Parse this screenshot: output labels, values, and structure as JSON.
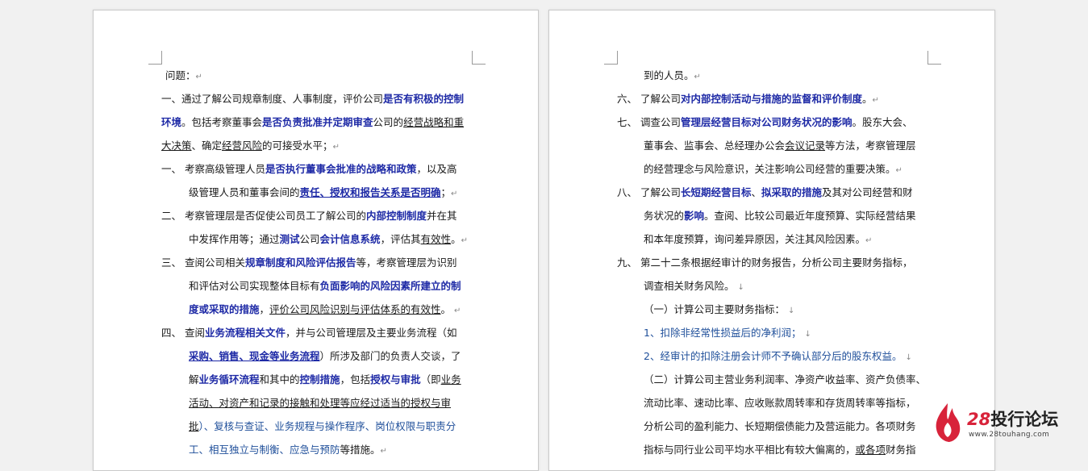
{
  "left_page": {
    "lines": [
      [
        {
          "t": "问题：",
          "s": ""
        },
        {
          "t": "↵",
          "s": "mark"
        }
      ],
      [
        {
          "t": "一、通过了解公司规章制度、人事制度，评价公司",
          "s": ""
        },
        {
          "t": "是否有积极的控制",
          "s": "b"
        }
      ],
      [
        {
          "t": "环境",
          "s": "b"
        },
        {
          "t": "。包括考察董事会",
          "s": ""
        },
        {
          "t": "是否负责批准并定期审查",
          "s": "b"
        },
        {
          "t": "公司的",
          "s": ""
        },
        {
          "t": "经营战略和重",
          "s": "u"
        }
      ],
      [
        {
          "t": "大决策",
          "s": "u"
        },
        {
          "t": "、确定",
          "s": ""
        },
        {
          "t": "经营风险",
          "s": "u"
        },
        {
          "t": "的可接受水平；",
          "s": ""
        },
        {
          "t": "↵",
          "s": "mark"
        }
      ],
      [
        {
          "t": "一、    考察高级管理人员",
          "s": ""
        },
        {
          "t": "是否执行董事会批准的战略和政策",
          "s": "b"
        },
        {
          "t": "，以及高",
          "s": ""
        }
      ],
      [
        {
          "t": "级管理人员和董事会间的",
          "s": ""
        },
        {
          "t": "责任、授权和报告关系是否明确",
          "s": "b u"
        },
        {
          "t": "；",
          "s": ""
        },
        {
          "t": "↵",
          "s": "mark"
        }
      ],
      [
        {
          "t": "二、    考察管理层是否促使公司员工了解公司的",
          "s": ""
        },
        {
          "t": "内部控制制度",
          "s": "b"
        },
        {
          "t": "并在其",
          "s": ""
        }
      ],
      [
        {
          "t": "中发挥作用等；通过",
          "s": ""
        },
        {
          "t": "测试",
          "s": "b"
        },
        {
          "t": "公司",
          "s": ""
        },
        {
          "t": "会计信息系统",
          "s": "b"
        },
        {
          "t": "，评估其",
          "s": ""
        },
        {
          "t": "有效性",
          "s": "u"
        },
        {
          "t": "。",
          "s": ""
        },
        {
          "t": "↵",
          "s": "mark"
        }
      ],
      [
        {
          "t": "三、    查阅公司相关",
          "s": ""
        },
        {
          "t": "规章制度和风险评估报告",
          "s": "b"
        },
        {
          "t": "等，考察管理层为识别",
          "s": ""
        }
      ],
      [
        {
          "t": "和评估对公司实现整体目标有",
          "s": ""
        },
        {
          "t": "负面影响的风险因素所建立的制",
          "s": "b"
        }
      ],
      [
        {
          "t": "度或采取的措施",
          "s": "b"
        },
        {
          "t": "，",
          "s": ""
        },
        {
          "t": "评价公司风险识别与评估体系的有效性",
          "s": "u"
        },
        {
          "t": "。 ",
          "s": ""
        },
        {
          "t": "↵",
          "s": "mark"
        }
      ],
      [
        {
          "t": "四、    查阅",
          "s": ""
        },
        {
          "t": "业务流程相关文件",
          "s": "b"
        },
        {
          "t": "，并与公司管理层及主要业务流程（如",
          "s": ""
        }
      ],
      [
        {
          "t": "采购、销售、现金等业务流程",
          "s": "b u"
        },
        {
          "t": "）所涉及部门的负责人交谈，了",
          "s": ""
        }
      ],
      [
        {
          "t": "解",
          "s": ""
        },
        {
          "t": "业务循环流程",
          "s": "b"
        },
        {
          "t": "和其中的",
          "s": ""
        },
        {
          "t": "控制措施",
          "s": "b"
        },
        {
          "t": "，包括",
          "s": ""
        },
        {
          "t": "授权与审批",
          "s": "b"
        },
        {
          "t": "（即",
          "s": ""
        },
        {
          "t": "业务",
          "s": "u"
        }
      ],
      [
        {
          "t": "活动、对资产和记录的接触和处理等应经过适当的授权与审",
          "s": "u"
        }
      ],
      [
        {
          "t": "批",
          "s": "u"
        },
        {
          "t": "）、复核与查证、业务规程与操作程序、岗位权限与职责分",
          "s": "blue"
        }
      ],
      [
        {
          "t": "工、相互独立与制衡、应急与预防",
          "s": "blue"
        },
        {
          "t": "等措施。",
          "s": ""
        },
        {
          "t": "↵",
          "s": "mark"
        }
      ]
    ]
  },
  "right_page": {
    "lines": [
      [
        {
          "t": "到的人员。",
          "s": ""
        },
        {
          "t": "↵",
          "s": "mark"
        }
      ],
      [
        {
          "t": "六、    了解公司",
          "s": ""
        },
        {
          "t": "对内部控制活动与措施的监督和评价制度",
          "s": "b"
        },
        {
          "t": "。",
          "s": ""
        },
        {
          "t": "↵",
          "s": "mark"
        }
      ],
      [
        {
          "t": "七、    调查公司",
          "s": ""
        },
        {
          "t": "管理层经营目标对公司财务状况的影响",
          "s": "b"
        },
        {
          "t": "。股东大会、",
          "s": ""
        }
      ],
      [
        {
          "t": "董事会、监事会、总经理办公会",
          "s": ""
        },
        {
          "t": "会议记录",
          "s": "u"
        },
        {
          "t": "等方法，考察管理层",
          "s": ""
        }
      ],
      [
        {
          "t": "的经营理念与风险意识，关注影响公司经营的重要决策。",
          "s": ""
        },
        {
          "t": "↵",
          "s": "mark"
        }
      ],
      [
        {
          "t": "八、    了解公司",
          "s": ""
        },
        {
          "t": "长短期经营目标",
          "s": "b"
        },
        {
          "t": "、",
          "s": ""
        },
        {
          "t": "拟采取的措施",
          "s": "b"
        },
        {
          "t": "及其对公司经营和财",
          "s": ""
        }
      ],
      [
        {
          "t": "务状况的",
          "s": ""
        },
        {
          "t": "影响",
          "s": "b"
        },
        {
          "t": "。查阅、比较公司最近年度预算、实际经营结果",
          "s": ""
        }
      ],
      [
        {
          "t": "和本年度预算，询问差异原因，关注其风险因素。",
          "s": ""
        },
        {
          "t": "↵",
          "s": "mark"
        }
      ],
      [
        {
          "t": "九、    第二十二条根据经审计的财务报告，分析公司主要财务指标，",
          "s": ""
        }
      ],
      [
        {
          "t": "调查相关财务风险。 ",
          "s": ""
        },
        {
          "t": "↓",
          "s": "mark"
        }
      ],
      [
        {
          "t": "（一）计算公司主要财务指标： ",
          "s": ""
        },
        {
          "t": "↓",
          "s": "mark"
        }
      ],
      [
        {
          "t": "1、扣除非经常性损益后的净利润； ",
          "s": "blue"
        },
        {
          "t": "↓",
          "s": "mark"
        }
      ],
      [
        {
          "t": "2、经审计的扣除注册会计师不予确认部分后的股东权益。 ",
          "s": "blue"
        },
        {
          "t": "↓",
          "s": "mark"
        }
      ],
      [
        {
          "t": "（二）计算公司主营业务利润率、净资产收益率、资产负债率、",
          "s": ""
        }
      ],
      [
        {
          "t": "流动比率、速动比率、应收账款周转率和存货周转率等指标，",
          "s": ""
        }
      ],
      [
        {
          "t": "分析公司的盈利能力、长短期偿债能力及营运能力。各项财务",
          "s": ""
        }
      ],
      [
        {
          "t": "指标与同行业公司平均水平相比有较大偏离的，",
          "s": ""
        },
        {
          "t": "或各项",
          "s": "u"
        },
        {
          "t": "财务指",
          "s": ""
        }
      ]
    ]
  },
  "watermark": {
    "number": "28",
    "name": "投行论坛",
    "url": "www.28touhang.com"
  },
  "colors": {
    "emphasis_blue": "#1e2aa6",
    "list_blue": "#1f4f9a",
    "logo_red": "#d8233a"
  }
}
